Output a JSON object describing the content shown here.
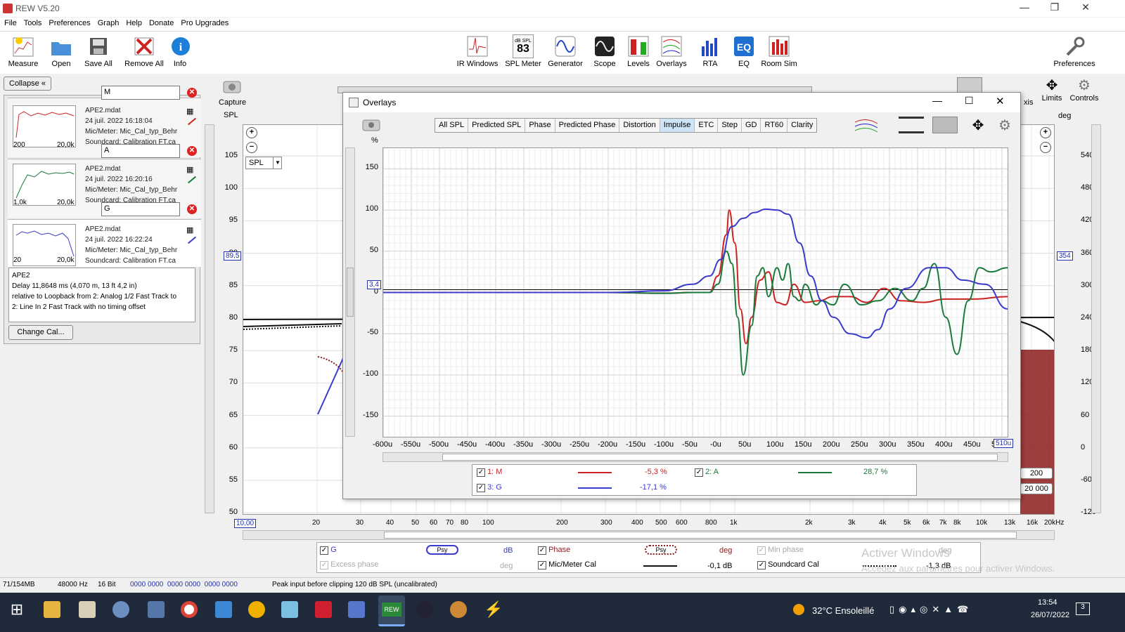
{
  "window": {
    "title": "REW V5.20"
  },
  "menu": [
    "File",
    "Tools",
    "Preferences",
    "Graph",
    "Help",
    "Donate",
    "Pro Upgrades"
  ],
  "toolbar_left": [
    {
      "label": "Measure",
      "icon": "measure-icon"
    },
    {
      "label": "Open",
      "icon": "folder-icon"
    },
    {
      "label": "Save All",
      "icon": "save-icon"
    },
    {
      "label": "Remove All",
      "icon": "remove-icon"
    },
    {
      "label": "Info",
      "icon": "info-icon"
    }
  ],
  "toolbar_center": [
    {
      "label": "IR Windows",
      "icon": "ir-windows-icon"
    },
    {
      "label": "SPL Meter",
      "icon": "spl-meter-icon",
      "display": "83",
      "display_unit": "dB SPL"
    },
    {
      "label": "Generator",
      "icon": "generator-icon"
    },
    {
      "label": "Scope",
      "icon": "scope-icon"
    },
    {
      "label": "Levels",
      "icon": "levels-icon"
    },
    {
      "label": "Overlays",
      "icon": "overlays-icon"
    },
    {
      "label": "RTA",
      "icon": "rta-icon"
    },
    {
      "label": "EQ",
      "icon": "eq-icon"
    },
    {
      "label": "Room Sim",
      "icon": "room-sim-icon"
    }
  ],
  "toolbar_right": {
    "label": "Preferences",
    "icon": "wrench-icon"
  },
  "panel": {
    "collapse_label": "Collapse",
    "change_cal_label": "Change Cal..."
  },
  "measurements": [
    {
      "num": "1",
      "name": "M",
      "file": "APE2.mdat",
      "date": "24 juil. 2022 16:18:04",
      "mic": "Mic/Meter: Mic_Cal_typ_Behr",
      "sound": "Soundcard: Calibration FT.ca",
      "xmin": "200",
      "xmax": "20,0k",
      "color": "#cc2222",
      "tag": "APE2"
    },
    {
      "num": "2",
      "name": "A",
      "file": "APE2.mdat",
      "date": "24 juil. 2022 16:20:16",
      "mic": "Mic/Meter: Mic_Cal_typ_Behr",
      "sound": "Soundcard: Calibration FT.ca",
      "xmin": "1,0k",
      "xmax": "20,0k",
      "color": "#1a7a3a",
      "tag": "APE2"
    },
    {
      "num": "3",
      "name": "G",
      "file": "APE2.mdat",
      "date": "24 juil. 2022 16:22:24",
      "mic": "Mic/Meter: Mic_Cal_typ_Behr",
      "sound": "Soundcard: Calibration FT.ca",
      "xmin": "20",
      "xmax": "20,0k",
      "color": "#3a3acc",
      "tag": "APE2"
    }
  ],
  "info": {
    "l1": "APE2",
    "l2": "Delay 11,8648 ms (4,070 m, 13 ft 4,2 in)",
    "l3": " relative to Loopback from 2: Analog 1/2 Fast Track to",
    "l4": "2: Line In 2 Fast Track with no timing offset"
  },
  "main_graph": {
    "capture_label": "Capture",
    "y_unit": "SPL",
    "select": "SPL",
    "y_ticks": [
      "105",
      "100",
      "95",
      "90",
      "85",
      "80",
      "75",
      "70",
      "65",
      "60",
      "55",
      "50"
    ],
    "x_ticks": [
      "10,00",
      "20",
      "30",
      "40",
      "50",
      "60",
      "70",
      "80",
      "100",
      "200",
      "300",
      "400",
      "500",
      "600",
      "800",
      "1k",
      "2k",
      "3k",
      "4k",
      "5k",
      "6k",
      "7k",
      "8k",
      "10k",
      "13k",
      "16k",
      "20kHz"
    ],
    "marker_left": "89,5",
    "marker_right": "354",
    "r_ticks": [
      "540",
      "480",
      "420",
      "360",
      "300",
      "240",
      "180",
      "120",
      "60",
      "0",
      "-60",
      "-120"
    ],
    "r_unit": "deg",
    "right_labels": {
      "axis": "xis",
      "limits": "Limits",
      "controls": "Controls"
    },
    "range_low": "200",
    "range_high": "20 000"
  },
  "overlays": {
    "title": "Overlays",
    "tabs": [
      "All SPL",
      "Predicted SPL",
      "Phase",
      "Predicted Phase",
      "Distortion",
      "Impulse",
      "ETC",
      "Step",
      "GD",
      "RT60",
      "Clarity"
    ],
    "selected_tab": "Impulse",
    "y_unit": "%",
    "marker": "3,4",
    "x_marker": "510u"
  },
  "chart_data": {
    "type": "line",
    "title": "",
    "xlabel": "",
    "ylabel": "%",
    "x_ticks": [
      "-600u",
      "-550u",
      "-500u",
      "-450u",
      "-400u",
      "-350u",
      "-300u",
      "-250u",
      "-200u",
      "-150u",
      "-100u",
      "-50u",
      "-0u",
      "50u",
      "100u",
      "150u",
      "200u",
      "250u",
      "300u",
      "350u",
      "400u",
      "450u",
      "5"
    ],
    "y_ticks": [
      "150",
      "100",
      "50",
      "0",
      "-50",
      "-100",
      "-150"
    ],
    "ylim": [
      -175,
      175
    ],
    "xlim": [
      -600,
      510
    ],
    "series": [
      {
        "name": "1: M",
        "color": "#cc2222",
        "level": "-5,3 %",
        "x": [
          -600,
          -200,
          -100,
          -50,
          -20,
          -5,
          10,
          15,
          25,
          35,
          45,
          55,
          70,
          85,
          100,
          115,
          130,
          150,
          175,
          200,
          230,
          260,
          290,
          320,
          360,
          400,
          450,
          510
        ],
        "y": [
          0,
          0,
          -1,
          0,
          0,
          20,
          70,
          100,
          60,
          -20,
          -62,
          -30,
          15,
          25,
          -12,
          -15,
          10,
          -12,
          -10,
          -5,
          -5,
          -12,
          5,
          -10,
          -12,
          -8,
          -8,
          -5
        ]
      },
      {
        "name": "2: A",
        "color": "#1a7a3a",
        "level": "28,7 %",
        "x": [
          -600,
          -200,
          -100,
          -50,
          -20,
          -5,
          10,
          20,
          30,
          40,
          55,
          65,
          75,
          85,
          100,
          110,
          120,
          130,
          140,
          150,
          170,
          180,
          200,
          220,
          250,
          280,
          310,
          340,
          360,
          380,
          400,
          420,
          440,
          460,
          480,
          510
        ],
        "y": [
          0,
          0,
          -1,
          0,
          0,
          10,
          50,
          35,
          -30,
          -100,
          -40,
          20,
          30,
          -5,
          30,
          15,
          35,
          -5,
          -10,
          10,
          -15,
          -10,
          -15,
          10,
          -15,
          -10,
          5,
          -10,
          5,
          35,
          -30,
          -75,
          -10,
          30,
          25,
          30
        ]
      },
      {
        "name": "3: G",
        "color": "#3a3acc",
        "level": "-17,1 %",
        "x": [
          -600,
          -300,
          -200,
          -100,
          -50,
          -20,
          0,
          20,
          40,
          60,
          80,
          100,
          120,
          140,
          160,
          180,
          200,
          230,
          260,
          280,
          300,
          330,
          370,
          400,
          430,
          470,
          510
        ],
        "y": [
          0,
          0,
          0,
          2,
          10,
          20,
          40,
          80,
          90,
          97,
          101,
          100,
          95,
          60,
          20,
          -10,
          -30,
          -50,
          -55,
          -45,
          -20,
          5,
          30,
          30,
          15,
          10,
          -20
        ]
      }
    ]
  },
  "bottom_legend": {
    "g_label": "G",
    "g_unit": "dB",
    "psy": "Psy",
    "phase_label": "Phase",
    "phase_unit": "deg",
    "minphase_label": "Min phase",
    "minphase_unit": "deg",
    "excess_label": "Excess phase",
    "excess_unit": "deg",
    "mic_label": "Mic/Meter Cal",
    "mic_val": "-0,1 dB",
    "sound_label": "Soundcard Cal",
    "sound_val": "-1,3 dB"
  },
  "watermark": {
    "l1": "Activer Windows",
    "l2": "Accédez aux paramètres pour activer Windows."
  },
  "status": {
    "mem": "71/154MB",
    "rate": "48000 Hz",
    "bits": "16 Bit",
    "hex": "0000 0000  0000 0000  0000 0000",
    "peak": "Peak input before clipping 120 dB SPL (uncalibrated)"
  },
  "taskbar": {
    "weather": "32°C  Ensoleillé",
    "time": "13:54",
    "date": "26/07/2022",
    "notif": "3"
  }
}
